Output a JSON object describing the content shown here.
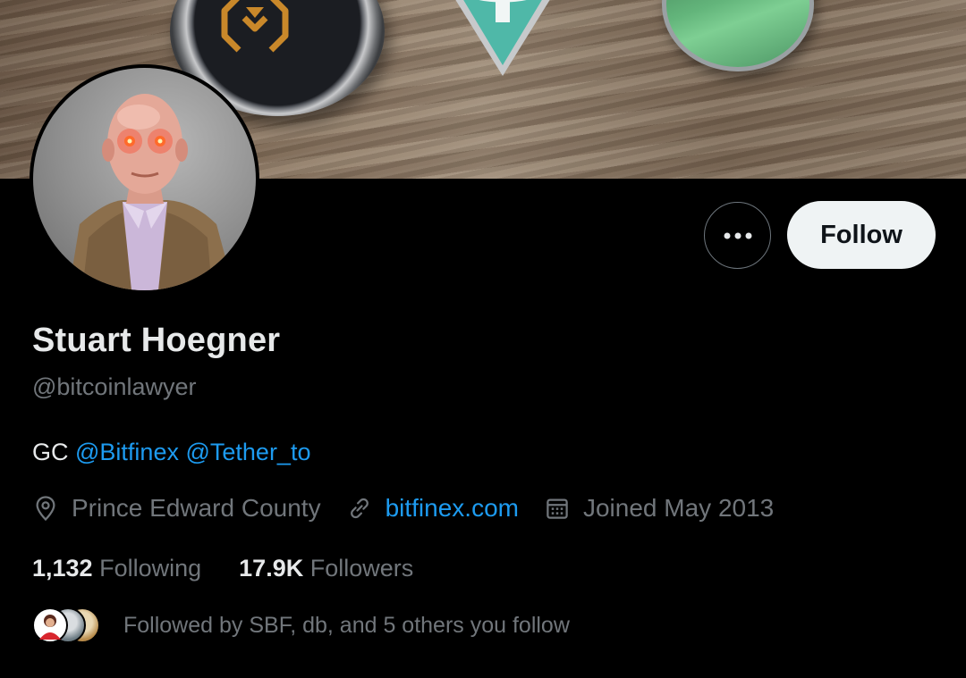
{
  "profile": {
    "name": "Stuart Hoegner",
    "handle": "@bitcoinlawyer",
    "bio_prefix": "GC",
    "bio_mentions": [
      "@Bitfinex",
      "@Tether_to"
    ],
    "location": "Prince Edward County",
    "website": "bitfinex.com",
    "joined": "Joined May 2013"
  },
  "actions": {
    "more_label": "•••",
    "follow_label": "Follow"
  },
  "stats": {
    "following_count": "1,132",
    "following_label": "Following",
    "followers_count": "17.9K",
    "followers_label": "Followers"
  },
  "followed_by": {
    "text": "Followed by SBF, db, and 5 others you follow"
  },
  "icons": {
    "location": "location-pin-icon",
    "website": "link-icon",
    "joined": "calendar-icon",
    "more": "more-dots-icon"
  },
  "colors": {
    "background": "#000000",
    "text_primary": "#e7e9ea",
    "text_secondary": "#71767b",
    "link": "#1d9bf0",
    "follow_button_bg": "#eff3f4",
    "follow_button_text": "#0f1419"
  }
}
